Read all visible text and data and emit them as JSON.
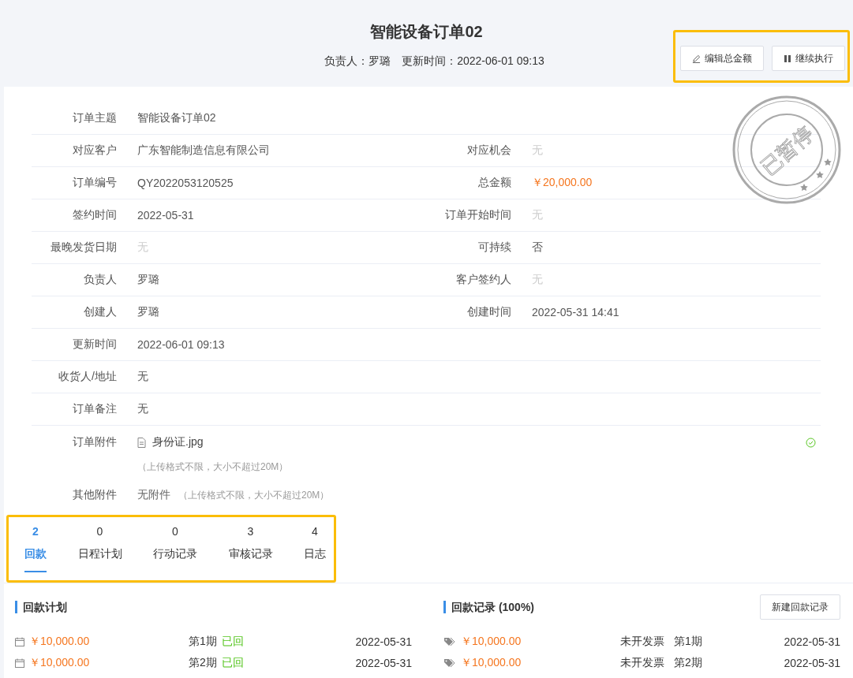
{
  "header": {
    "title": "智能设备订单02",
    "owner_label": "负责人：",
    "owner": "罗璐",
    "updated_label": "更新时间：",
    "updated": "2022-06-01 09:13"
  },
  "actions": [
    {
      "label": "编辑总金额",
      "kind": "edit"
    },
    {
      "label": "继续执行",
      "kind": "resume"
    }
  ],
  "stamp": {
    "text": "已暂停"
  },
  "fields": [
    {
      "left": {
        "label": "订单主题",
        "value": "智能设备订单02",
        "kind": "text"
      }
    },
    {
      "left": {
        "label": "对应客户",
        "value": "广东智能制造信息有限公司",
        "kind": "text"
      },
      "right": {
        "label": "对应机会",
        "value": "无",
        "kind": "empty"
      }
    },
    {
      "left": {
        "label": "订单编号",
        "value": "QY2022053120525",
        "kind": "text"
      },
      "right": {
        "label": "总金额",
        "value": "￥20,000.00",
        "kind": "money"
      }
    },
    {
      "left": {
        "label": "签约时间",
        "value": "2022-05-31",
        "kind": "text"
      },
      "right": {
        "label": "订单开始时间",
        "value": "无",
        "kind": "empty"
      }
    },
    {
      "left": {
        "label": "最晚发货日期",
        "value": "无",
        "kind": "empty"
      },
      "right": {
        "label": "可持续",
        "value": "否",
        "kind": "text"
      }
    },
    {
      "left": {
        "label": "负责人",
        "value": "罗璐",
        "kind": "text"
      },
      "right": {
        "label": "客户签约人",
        "value": "无",
        "kind": "empty"
      }
    },
    {
      "left": {
        "label": "创建人",
        "value": "罗璐",
        "kind": "text"
      },
      "right": {
        "label": "创建时间",
        "value": "2022-05-31 14:41",
        "kind": "text"
      }
    },
    {
      "left": {
        "label": "更新时间",
        "value": "2022-06-01 09:13",
        "kind": "text"
      }
    },
    {
      "left": {
        "label": "收货人/地址",
        "value": "无",
        "kind": "text"
      }
    },
    {
      "left": {
        "label": "订单备注",
        "value": "无",
        "kind": "text"
      }
    }
  ],
  "attachments": {
    "label": "订单附件",
    "file": "身份证.jpg",
    "uploaded": true,
    "hint": "（上传格式不限，大小不超过20M）"
  },
  "other_attachments": {
    "label": "其他附件",
    "value": "无附件",
    "hint": "（上传格式不限，大小不超过20M）"
  },
  "tabs": [
    {
      "count": "2",
      "label": "回款",
      "selected": true
    },
    {
      "count": "0",
      "label": "日程计划",
      "selected": false
    },
    {
      "count": "0",
      "label": "行动记录",
      "selected": false
    },
    {
      "count": "3",
      "label": "审核记录",
      "selected": false
    },
    {
      "count": "4",
      "label": "日志",
      "selected": false
    }
  ],
  "plan": {
    "title": "回款计划",
    "rows": [
      {
        "amount": "￥10,000.00",
        "period": "第1期",
        "status": "已回",
        "date": "2022-05-31"
      },
      {
        "amount": "￥10,000.00",
        "period": "第2期",
        "status": "已回",
        "date": "2022-05-31"
      }
    ]
  },
  "records": {
    "title": "回款记录 (100%)",
    "button": "新建回款记录",
    "rows": [
      {
        "amount": "￥10,000.00",
        "invoice": "未开发票",
        "period": "第1期",
        "date": "2022-05-31"
      },
      {
        "amount": "￥10,000.00",
        "invoice": "未开发票",
        "period": "第2期",
        "date": "2022-05-31"
      }
    ]
  }
}
